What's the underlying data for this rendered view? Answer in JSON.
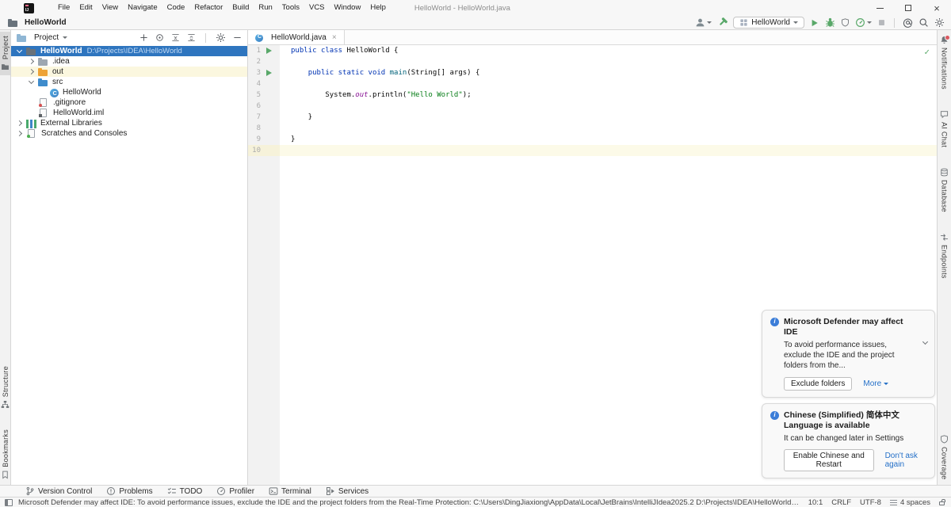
{
  "window": {
    "title": "HelloWorld - HelloWorld.java"
  },
  "menubar": [
    "File",
    "Edit",
    "View",
    "Navigate",
    "Code",
    "Refactor",
    "Build",
    "Run",
    "Tools",
    "VCS",
    "Window",
    "Help"
  ],
  "navbar": {
    "project": "HelloWorld"
  },
  "run_widget": {
    "config_name": "HelloWorld"
  },
  "project_panel": {
    "title": "Project",
    "tree": [
      {
        "depth": 0,
        "arrow": "v",
        "icon": "project-folder",
        "label": "HelloWorld",
        "hint": "D:\\Projects\\IDEA\\HelloWorld",
        "state": "selected"
      },
      {
        "depth": 1,
        "arrow": ">",
        "icon": "folder",
        "label": ".idea"
      },
      {
        "depth": 1,
        "arrow": ">",
        "icon": "folder-excluded",
        "label": "out",
        "state": "highlight"
      },
      {
        "depth": 1,
        "arrow": "v",
        "icon": "folder-source",
        "label": "src"
      },
      {
        "depth": 2,
        "arrow": "",
        "icon": "java-class",
        "label": "HelloWorld"
      },
      {
        "depth": 1,
        "arrow": "",
        "icon": "gitignore-file",
        "label": ".gitignore"
      },
      {
        "depth": 1,
        "arrow": "",
        "icon": "module-file",
        "label": "HelloWorld.iml"
      },
      {
        "depth": 0,
        "arrow": ">",
        "icon": "libraries",
        "label": "External Libraries"
      },
      {
        "depth": 0,
        "arrow": ">",
        "icon": "scratches",
        "label": "Scratches and Consoles"
      }
    ]
  },
  "editor": {
    "tab": {
      "label": "HelloWorld.java"
    },
    "inspection_status": "ok",
    "lines": [
      {
        "n": 1,
        "gutter": "run",
        "tokens": [
          {
            "t": "public ",
            "c": "kw"
          },
          {
            "t": "class ",
            "c": "kw"
          },
          {
            "t": "HelloWorld {",
            "c": "pl"
          }
        ]
      },
      {
        "n": 2,
        "tokens": []
      },
      {
        "n": 3,
        "gutter": "run",
        "tokens": [
          {
            "t": "    ",
            "c": "pl"
          },
          {
            "t": "public static void ",
            "c": "kw"
          },
          {
            "t": "main",
            "c": "decl"
          },
          {
            "t": "(String[] args) {",
            "c": "pl"
          }
        ]
      },
      {
        "n": 4,
        "tokens": []
      },
      {
        "n": 5,
        "tokens": [
          {
            "t": "        System.",
            "c": "pl"
          },
          {
            "t": "out",
            "c": "field"
          },
          {
            "t": ".println(",
            "c": "pl"
          },
          {
            "t": "\"Hello World\"",
            "c": "str"
          },
          {
            "t": ");",
            "c": "pl"
          }
        ]
      },
      {
        "n": 6,
        "tokens": []
      },
      {
        "n": 7,
        "tokens": [
          {
            "t": "    }",
            "c": "pl"
          }
        ]
      },
      {
        "n": 8,
        "tokens": []
      },
      {
        "n": 9,
        "tokens": [
          {
            "t": "}",
            "c": "pl"
          }
        ]
      },
      {
        "n": 10,
        "caret": true,
        "tokens": []
      }
    ]
  },
  "stripes": {
    "left_top": [
      {
        "label": "Project",
        "icon": "project",
        "active": true
      }
    ],
    "left_bottom": [
      {
        "label": "Structure",
        "icon": "structure"
      },
      {
        "label": "Bookmarks",
        "icon": "bookmarks"
      }
    ],
    "right_top": [
      {
        "label": "Notifications",
        "icon": "notifications",
        "badge": true
      },
      {
        "label": "AI Chat",
        "icon": "ai-chat"
      },
      {
        "label": "Database",
        "icon": "database"
      },
      {
        "label": "Endpoints",
        "icon": "endpoints"
      }
    ],
    "right_bottom": [
      {
        "label": "Coverage",
        "icon": "coverage"
      }
    ]
  },
  "notifications": [
    {
      "title": "Microsoft Defender may affect IDE",
      "body": "To avoid performance issues, exclude the IDE and the project folders from the...",
      "collapsible": true,
      "actions": [
        {
          "label": "Exclude folders",
          "type": "button"
        },
        {
          "label": "More",
          "type": "link",
          "chevron": true
        }
      ]
    },
    {
      "title": "Chinese (Simplified) 简体中文 Language is available",
      "body": "It can be changed later in Settings",
      "collapsible": false,
      "actions": [
        {
          "label": "Enable Chinese and Restart",
          "type": "button"
        },
        {
          "label": "Don't ask again",
          "type": "link"
        }
      ]
    }
  ],
  "bottom_bar": [
    {
      "label": "Version Control",
      "icon": "version-control"
    },
    {
      "label": "Problems",
      "icon": "problems"
    },
    {
      "label": "TODO",
      "icon": "todo"
    },
    {
      "label": "Profiler",
      "icon": "profiler"
    },
    {
      "label": "Terminal",
      "icon": "terminal"
    },
    {
      "label": "Services",
      "icon": "services"
    }
  ],
  "status_bar": {
    "message": "Microsoft Defender may affect IDE: To avoid performance issues, exclude the IDE and the project folders from the Real-Time Protection: C:\\Users\\DingJiaxiong\\AppData\\Local\\JetBrains\\IntelliJIdea2025.2 D:\\Projects\\IDEA\\HelloWorld Windows will prom... (moments ago)",
    "caret_position": "10:1",
    "line_separator": "CRLF",
    "encoding": "UTF-8",
    "indent": "4 spaces"
  },
  "colors": {
    "selection_blue": "#2E75BF",
    "run_green": "#59A869",
    "link_blue": "#2470C8",
    "caret_line": "#FCFAE8",
    "excluded_row": "#FBF7DF"
  }
}
